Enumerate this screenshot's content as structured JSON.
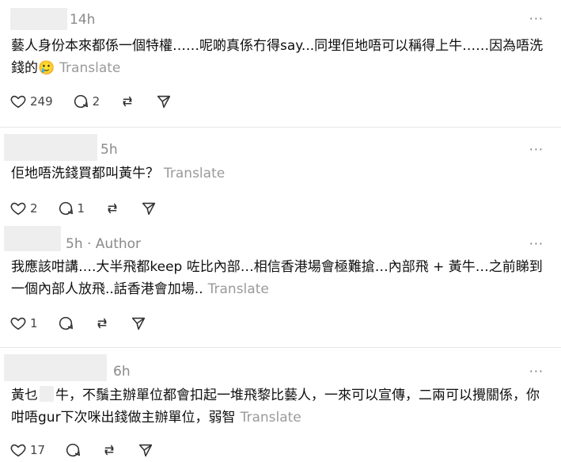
{
  "posts": [
    {
      "time": "14h",
      "author_tag": "",
      "text": "藝人身份本來都係一個特權……呢啲真係冇得say...同埋佢地唔可以稱得上牛……因為唔洗錢的🥲",
      "translate": "Translate",
      "likes": "249",
      "replies": "2",
      "reposts": "",
      "shares": ""
    },
    {
      "time": "5h",
      "author_tag": "",
      "text": "佢地唔洗錢買都叫黃牛？",
      "translate": "Translate",
      "likes": "2",
      "replies": "1",
      "reposts": "",
      "shares": ""
    },
    {
      "time": "5h",
      "author_tag": "· Author",
      "text": "我應該咁講….大半飛都keep 咗比內部…相信香港場會極難搶…內部飛 + 黃牛…之前睇到一個內部人放飛..話香港會加場..",
      "translate": "Translate",
      "likes": "1",
      "replies": "",
      "reposts": "",
      "shares": ""
    },
    {
      "time": "6h",
      "author_tag": "",
      "text_before": "黃乜",
      "text_after": "牛，不鬚主辦單位都會扣起一堆飛黎比藝人，一來可以宣傳，二兩可以攪關係，你咁唔gur下次咪出錢做主辦單位，弱智",
      "translate": "Translate",
      "likes": "17",
      "replies": "",
      "reposts": "",
      "shares": ""
    }
  ],
  "more_label": "···",
  "icons": [
    "heart-icon",
    "comment-icon",
    "repost-icon",
    "send-icon",
    "more-icon"
  ]
}
